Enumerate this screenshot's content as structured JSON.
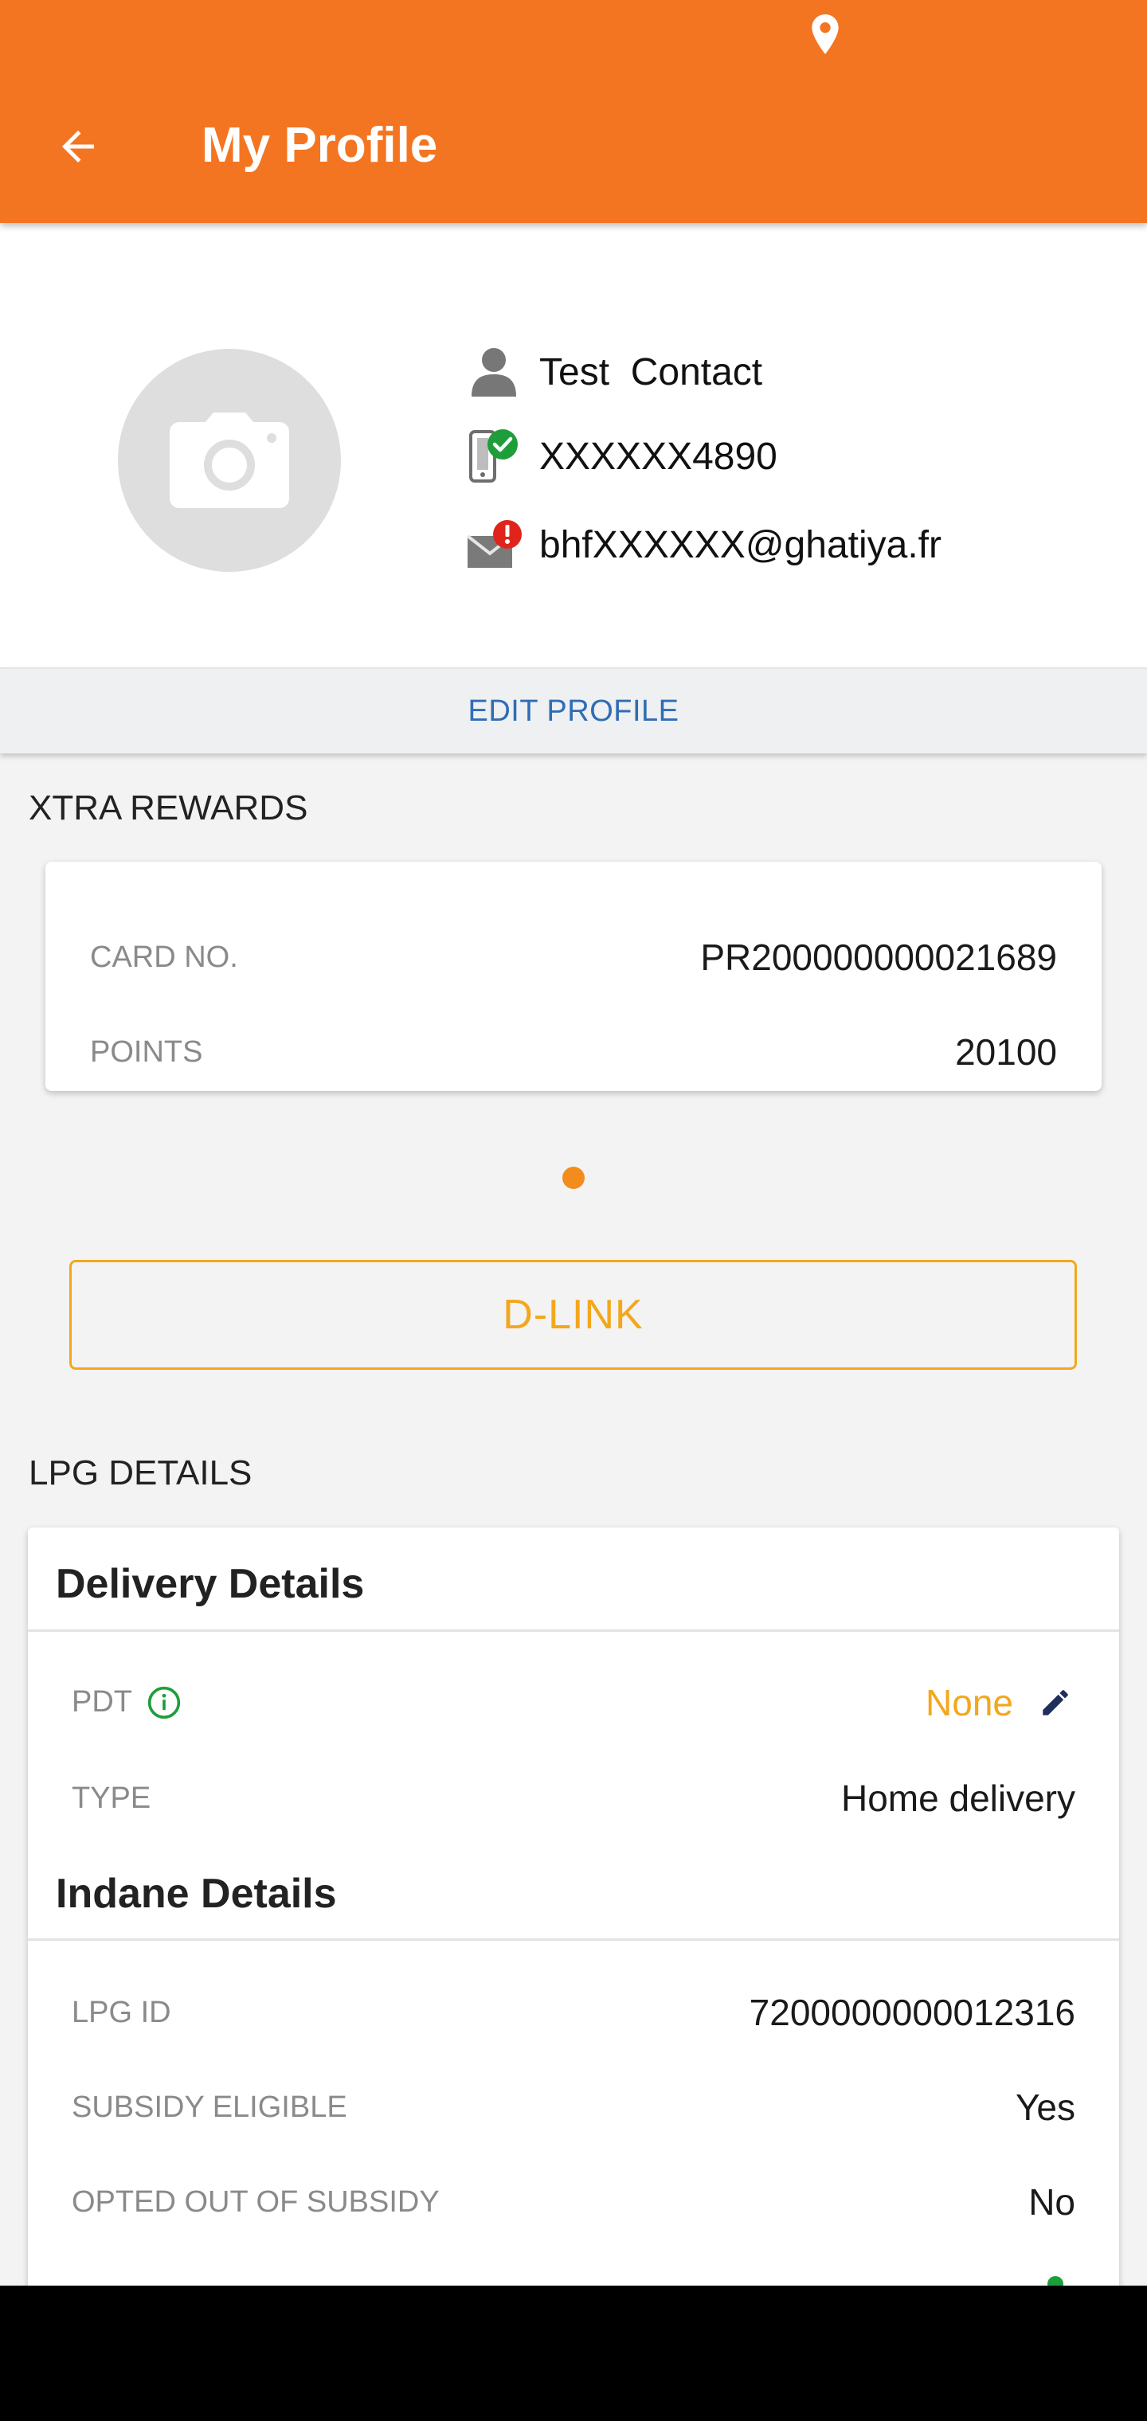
{
  "app_bar": {
    "title": "My Profile",
    "background": "#f47521",
    "back_icon": "arrow-back-icon",
    "status_icon": "location-pin-icon"
  },
  "profile": {
    "avatar_icon": "camera-icon",
    "name": "Test  Contact",
    "name_icon": "person-icon",
    "phone": "XXXXXX4890",
    "phone_icon": "phone-verified-icon",
    "email": "bhfXXXXXX@ghatiya.fr",
    "email_icon": "email-unverified-icon",
    "edit_label": "EDIT PROFILE"
  },
  "rewards": {
    "section_title": "XTRA REWARDS",
    "card_no_label": "CARD NO.",
    "card_no_value": "PR200000000021689",
    "points_label": "POINTS",
    "points_value": "20100",
    "dlink_label": "D-LINK"
  },
  "lpg": {
    "section_title": "LPG DETAILS",
    "delivery": {
      "heading": "Delivery Details",
      "pdt_label": "PDT",
      "pdt_value": "None",
      "type_label": "TYPE",
      "type_value": "Home delivery"
    },
    "indane": {
      "heading": "Indane Details",
      "rows": [
        {
          "label": "LPG ID",
          "value": "7200000000012316"
        },
        {
          "label": "SUBSIDY ELIGIBLE",
          "value": "Yes"
        },
        {
          "label": "OPTED OUT OF SUBSIDY",
          "value": "No"
        }
      ]
    }
  },
  "colors": {
    "accent_orange": "#f47521",
    "link_blue": "#2f6db5",
    "gold": "#f3a71c",
    "success_green": "#1e9e3a",
    "error_red": "#e0241b"
  }
}
